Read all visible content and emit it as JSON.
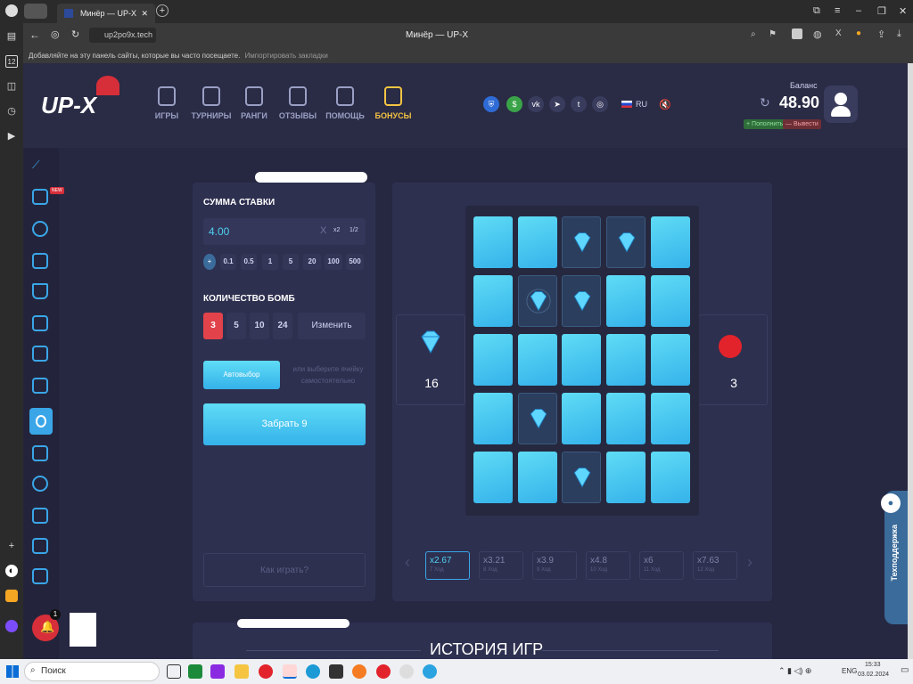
{
  "browser": {
    "tab_title": "Минёр — UP-X",
    "window_title": "Минёр — UP-X",
    "url": "up2po9x.tech",
    "bookmarks_hint": "Добавляйте на эту панель сайты, которые вы часто посещаете.",
    "import_link": "Импортировать закладки",
    "sidebar_badge": "12"
  },
  "site": {
    "logo": "UP-X",
    "nav": [
      {
        "label": "ИГРЫ"
      },
      {
        "label": "ТУРНИРЫ"
      },
      {
        "label": "РАНГИ"
      },
      {
        "label": "ОТЗЫВЫ"
      },
      {
        "label": "ПОМОЩЬ"
      },
      {
        "label": "БОНУСЫ"
      }
    ],
    "lang": "RU",
    "balance_label": "Баланс",
    "balance_value": "48.90",
    "deposit": "+ Пополнить",
    "withdraw": "— Вывести",
    "new_badge": "NEW"
  },
  "game": {
    "bet_label": "СУММА СТАВКИ",
    "bet_value": "4.00",
    "clear": "X",
    "x2": "x2",
    "half": "1/2",
    "quick_bets": [
      "+",
      "0.1",
      "0.5",
      "1",
      "5",
      "20",
      "100",
      "500"
    ],
    "bombs_label": "КОЛИЧЕСТВО БОМБ",
    "bomb_options": [
      "3",
      "5",
      "10",
      "24"
    ],
    "change": "Изменить",
    "autoselect": "Автовыбор",
    "hint": "или выберите ячейку самостоятельно",
    "collect": "Забрать 9",
    "how_to": "Как играть?",
    "gems_left": "16",
    "bombs_count": "3",
    "multipliers": [
      {
        "value": "x2.67",
        "step": "7 Ход"
      },
      {
        "value": "x3.21",
        "step": "8 Ход"
      },
      {
        "value": "x3.9",
        "step": "9 Ход"
      },
      {
        "value": "x4.8",
        "step": "10 Ход"
      },
      {
        "value": "x6",
        "step": "11 Ход"
      },
      {
        "value": "x7.63",
        "step": "12 Ход"
      }
    ],
    "history_title": "ИСТОРИЯ ИГР",
    "support": "Техподдержка",
    "notif_count": "1"
  },
  "taskbar": {
    "search": "Поиск",
    "lang": "ENG",
    "time": "15:33",
    "date": "03.02.2024"
  },
  "colors": {
    "accent": "#4fd1f0",
    "bomb_active": "#e2434b",
    "bonus": "#f5c542"
  }
}
